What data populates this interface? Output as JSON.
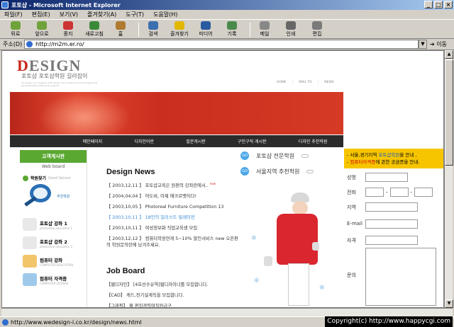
{
  "window": {
    "title": "포토샵 - Microsoft Internet Explorer",
    "controls": [
      "_",
      "□",
      "×"
    ]
  },
  "menu": [
    "파일(F)",
    "편집(E)",
    "보기(V)",
    "즐겨찾기(A)",
    "도구(T)",
    "도움말(H)"
  ],
  "toolbar": [
    {
      "label": "뒤로",
      "icon": "back-arrow-icon"
    },
    {
      "label": "앞으로",
      "icon": "forward-arrow-icon"
    },
    {
      "label": "중지",
      "icon": "stop-icon"
    },
    {
      "label": "새로고침",
      "icon": "refresh-icon"
    },
    {
      "label": "홈",
      "icon": "home-icon"
    },
    {
      "label": "검색",
      "icon": "search-icon"
    },
    {
      "label": "즐겨찾기",
      "icon": "favorites-icon"
    },
    {
      "label": "미디어",
      "icon": "media-icon"
    },
    {
      "label": "기록",
      "icon": "history-icon"
    },
    {
      "label": "메일",
      "icon": "mail-icon"
    },
    {
      "label": "인쇄",
      "icon": "print-icon"
    },
    {
      "label": "편집",
      "icon": "edit-icon"
    }
  ],
  "address": {
    "label": "주소(D)",
    "url": "http://m2m.er.ro/",
    "go": "이동"
  },
  "status": {
    "url": "http://www.wedesign-i.co.kr/design/news.html",
    "copyright": "Copyright(c) http://www.happycgi.com"
  },
  "site": {
    "logo_d": "D",
    "logo_rest": "ESIGN",
    "logo_sub": "포토샵 포토샵학원 길라잡이",
    "logo_tiny": "we design you, together with design. This creative and technology that generate best professional network",
    "topnav": [
      "HOME",
      "MAIL TO",
      "NEWS"
    ],
    "nav": [
      "메인페이지",
      "디자인이란",
      "질문게시판",
      "구인구직 게시판",
      "디자인 추천학원"
    ],
    "sidebar": {
      "head": "고객게시판",
      "head2": "Web board",
      "find": "학원찾기",
      "find_en": "Good Seince",
      "magnifier_caption": "추천학원",
      "courses": [
        {
          "title": "포토샵 강좌 1",
          "sub": "photoshop education 1",
          "color": "#e8e8e8"
        },
        {
          "title": "포토샵 강좌 2",
          "sub": "photoshop education 2",
          "color": "#e8e8e8"
        },
        {
          "title": "컴퓨터 강좌",
          "sub": "COMPUTER EDUCATION",
          "color": "#f3c56b"
        },
        {
          "title": "컴퓨터 자격증",
          "sub": "COMPUTER LICENSE",
          "color": "#9fc9ea"
        }
      ]
    },
    "news": {
      "title": "Design News",
      "items": [
        {
          "text": "【 2003,12,11 】 포토샵교육은 원편의 강좌란에서..",
          "new": "new",
          "hl": false
        },
        {
          "text": "【 2004,04,04 】 어도비, 이제 애크로뱃이다!",
          "new": "",
          "hl": false
        },
        {
          "text": "【 2003,10,05 】 Photoreal Furniture Competition 13",
          "new": "",
          "hl": false
        },
        {
          "text": "【 2003,10,11 】 18인의 일러스트 릴레이전",
          "new": "",
          "hl": true
        },
        {
          "text": "【 2003,10,11 】 여성정보화 직업교육생 모집",
          "new": "",
          "hl": false
        },
        {
          "text": "【 2003,12,12 】 컴퓨터학원연계 5~10% 할인서비스 new 오픈편의 학원문의란에 남겨주세요.",
          "new": "",
          "hl": false
        }
      ]
    },
    "job": {
      "title": "Job Board",
      "items": [
        "【웹디자인】 [4호선수유역]웹디자이너를 모집합니다.",
        "【CAD】 캐드,전기설계직을 모집합니다.",
        "【그래픽】 웹 편집경력여직원급구"
      ]
    },
    "promo": [
      {
        "badge": "GO",
        "text": "포토샵 전문학원"
      },
      {
        "badge": "GO",
        "text": "서울지역 추천학원"
      }
    ],
    "notice": {
      "line1a": "- 서울,경기지역 ",
      "line1b": "포토샵학원",
      "line1c": "을 안내 ,",
      "line2a": "- ",
      "line2b": "컴퓨터자격증",
      "line2c": "에 관한 궁금증을 안내."
    },
    "form": {
      "name": "성명",
      "phone": "전화",
      "region": "지역",
      "email": "E-mail",
      "cert": "자격",
      "question": "문의"
    }
  }
}
